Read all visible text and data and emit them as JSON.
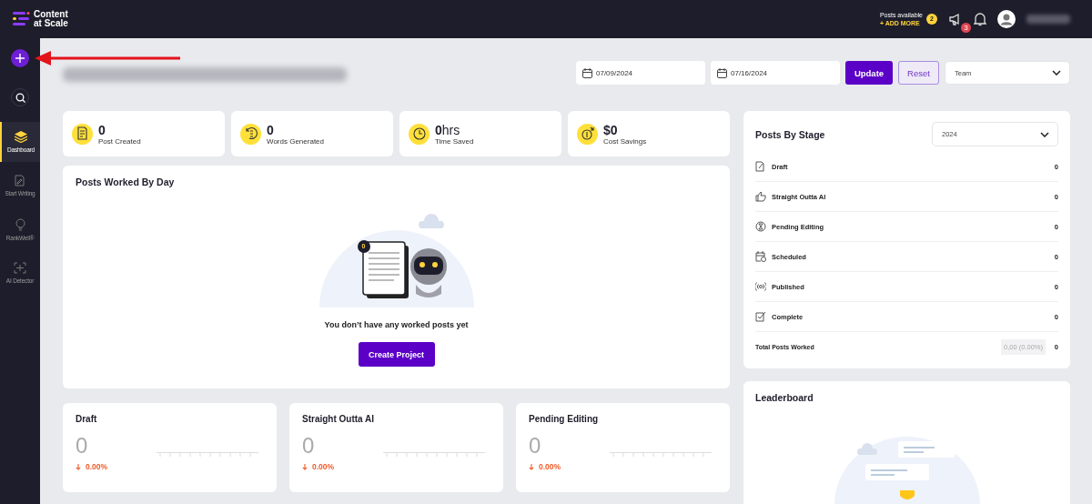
{
  "topbar": {
    "logo_lines": [
      "Content",
      "at Scale"
    ],
    "posts_available": "Posts available",
    "add_more": "+ ADD MORE",
    "posts_count": "2",
    "announcements_count": "3"
  },
  "sidebar": {
    "items": [
      {
        "label": "Dashboard",
        "selected": true
      },
      {
        "label": "Start Writing",
        "selected": false
      },
      {
        "label": "RankWell®",
        "selected": false
      },
      {
        "label": "AI Detector",
        "selected": false
      }
    ]
  },
  "filters": {
    "start_date": "07/09/2024",
    "end_date": "07/16/2024",
    "update": "Update",
    "reset": "Reset",
    "team": "Team"
  },
  "stats": [
    {
      "value": "0",
      "label": "Post Created"
    },
    {
      "value": "0",
      "label": "Words Generated"
    },
    {
      "value": "0",
      "unit": "hrs",
      "label": "Time Saved"
    },
    {
      "value": "$0",
      "label": "Cost Savings"
    }
  ],
  "posts_worked_by_day": {
    "title": "Posts Worked By Day",
    "illustration_badge": "0",
    "empty_text": "You don’t have any worked posts yet",
    "button": "Create Project"
  },
  "posts_by_stage": {
    "title": "Posts By Stage",
    "year": "2024",
    "stages": [
      {
        "label": "Draft",
        "count": "0"
      },
      {
        "label": "Straight Outta AI",
        "count": "0"
      },
      {
        "label": "Pending Editing",
        "count": "0"
      },
      {
        "label": "Scheduled",
        "count": "0"
      },
      {
        "label": "Published",
        "count": "0"
      },
      {
        "label": "Complete",
        "count": "0"
      }
    ],
    "total_label": "Total Posts Worked",
    "total_detail": "0,00 (0.00%)",
    "total": "0"
  },
  "stage_cards": [
    {
      "title": "Draft",
      "value": "0",
      "change": "0.00%"
    },
    {
      "title": "Straight Outta AI",
      "value": "0",
      "change": "0.00%"
    },
    {
      "title": "Pending Editing",
      "value": "0",
      "change": "0.00%"
    }
  ],
  "leaderboard": {
    "title": "Leaderboard"
  }
}
